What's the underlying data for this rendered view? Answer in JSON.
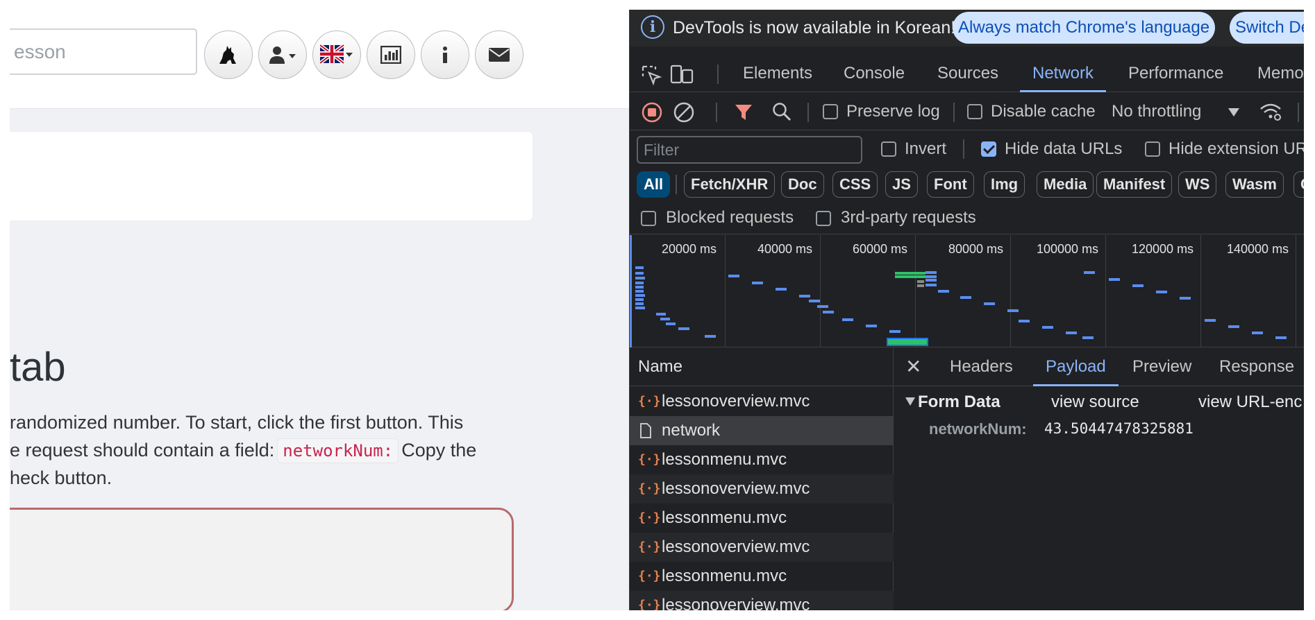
{
  "page": {
    "search_placeholder": "esson",
    "lesson_title": "tab",
    "paragraph": {
      "line1": "randomized number. To start, click the first button. This",
      "line2_before": "e request should contain a field:",
      "line2_code": "networkNum:",
      "line2_after": "Copy the",
      "line3": "heck button."
    },
    "accent_color": "#b86a6a"
  },
  "devtools": {
    "infobar": {
      "message": "DevTools is now available in Korean!",
      "primary_button": "Always match Chrome's language",
      "secondary_button": "Switch De"
    },
    "main_tabs": [
      "Elements",
      "Console",
      "Sources",
      "Network",
      "Performance",
      "Memo"
    ],
    "active_main_tab": "Network",
    "toolbar": {
      "preserve_log": "Preserve log",
      "preserve_log_checked": false,
      "disable_cache": "Disable cache",
      "disable_cache_checked": false,
      "throttling": "No throttling"
    },
    "filter": {
      "placeholder": "Filter",
      "invert": "Invert",
      "invert_checked": false,
      "hide_data_urls": "Hide data URLs",
      "hide_data_urls_checked": true,
      "hide_extension_urls": "Hide extension UR",
      "hide_extension_urls_checked": false
    },
    "type_filters": [
      "All",
      "Fetch/XHR",
      "Doc",
      "CSS",
      "JS",
      "Font",
      "Img",
      "Media",
      "Manifest",
      "WS",
      "Wasm",
      "C"
    ],
    "active_type_filter": "All",
    "blocked_requests": "Blocked requests",
    "third_party_requests": "3rd-party requests",
    "timeline_ticks": [
      "20000 ms",
      "40000 ms",
      "60000 ms",
      "80000 ms",
      "100000 ms",
      "120000 ms",
      "140000 ms"
    ],
    "name_column_header": "Name",
    "requests": [
      {
        "name": "lessonoverview.mvc",
        "type": "xhr"
      },
      {
        "name": "network",
        "type": "doc"
      },
      {
        "name": "lessonmenu.mvc",
        "type": "xhr"
      },
      {
        "name": "lessonoverview.mvc",
        "type": "xhr"
      },
      {
        "name": "lessonmenu.mvc",
        "type": "xhr"
      },
      {
        "name": "lessonoverview.mvc",
        "type": "xhr"
      },
      {
        "name": "lessonmenu.mvc",
        "type": "xhr"
      },
      {
        "name": "lessonoverview.mvc",
        "type": "xhr"
      }
    ],
    "selected_request": "network",
    "detail_tabs": [
      "Headers",
      "Payload",
      "Preview",
      "Response"
    ],
    "active_detail_tab": "Payload",
    "payload": {
      "section_title": "Form Data",
      "view_source": "view source",
      "view_url_encoded": "view URL-enc",
      "field_name": "networkNum:",
      "field_value": "43.50447478325881"
    },
    "accent_color": "#8ab4f8"
  }
}
